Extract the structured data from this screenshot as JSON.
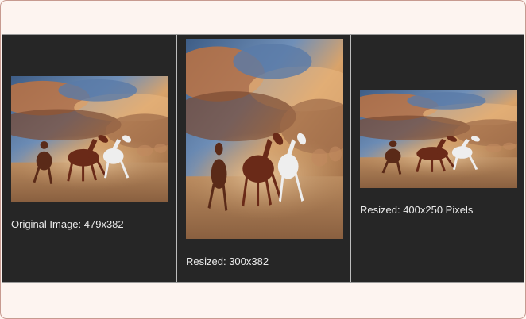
{
  "gallery": {
    "items": [
      {
        "caption": "Original Image: 479x382"
      },
      {
        "caption": "Resized: 300x382"
      },
      {
        "caption": "Resized: 400x250 Pixels"
      }
    ]
  },
  "colors": {
    "page_background": "#fdf4f0",
    "panel_background": "#262626",
    "caption_text": "#eaeaea"
  }
}
